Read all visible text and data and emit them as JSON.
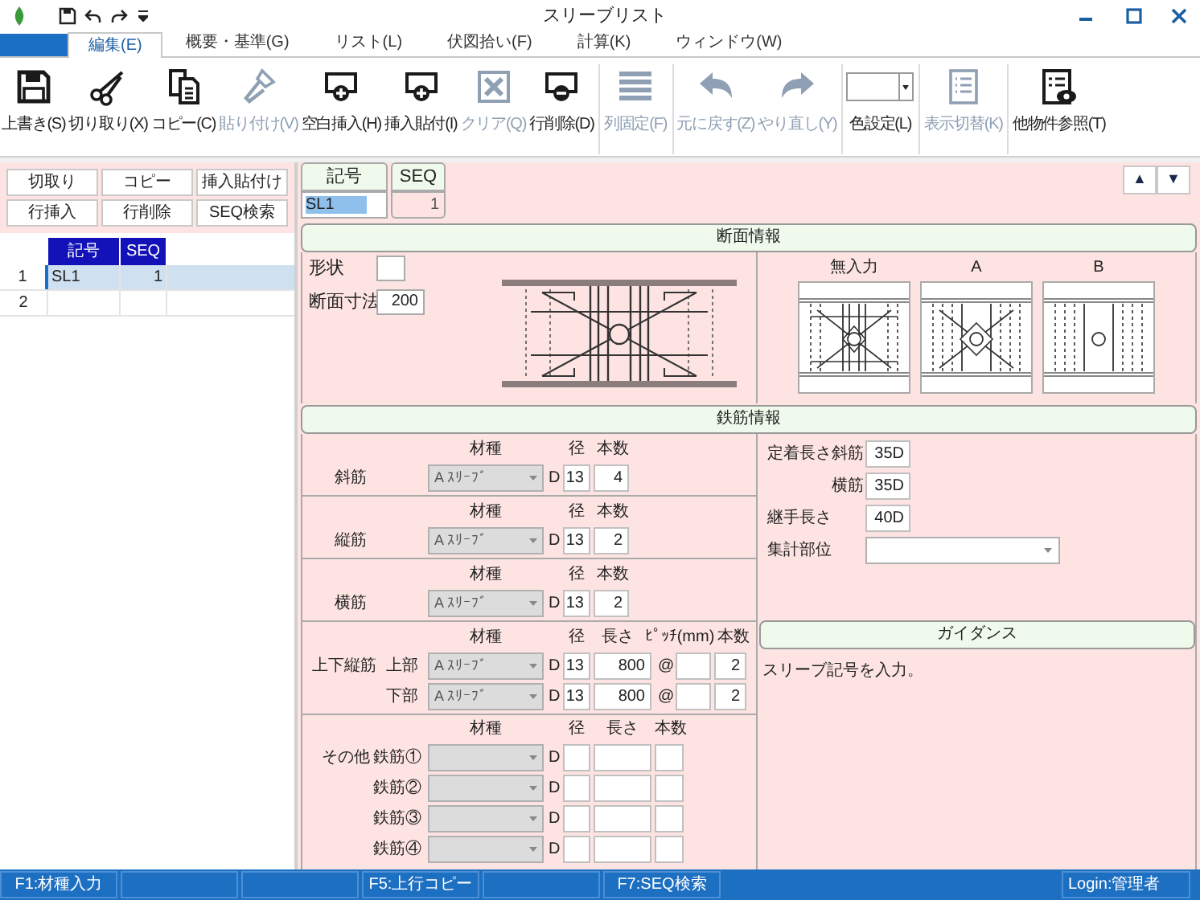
{
  "window": {
    "title": "スリーブリスト"
  },
  "tabs": [
    {
      "label": "編集(E)",
      "selected": true
    },
    {
      "label": "概要・基準(G)",
      "selected": false
    },
    {
      "label": "リスト(L)",
      "selected": false
    },
    {
      "label": "伏図拾い(F)",
      "selected": false
    },
    {
      "label": "計算(K)",
      "selected": false
    },
    {
      "label": "ウィンドウ(W)",
      "selected": false
    }
  ],
  "ribbon_groups": [
    [
      {
        "label": "上書き(S)",
        "kind": "save",
        "disabled": false
      },
      {
        "label": "切り取り(X)",
        "kind": "cut",
        "disabled": false
      },
      {
        "label": "コピー(C)",
        "kind": "copy",
        "disabled": false
      },
      {
        "label": "貼り付け(V)",
        "kind": "paste",
        "disabled": true
      },
      {
        "label": "空白挿入(H)",
        "kind": "insert",
        "disabled": false
      },
      {
        "label": "挿入貼付(I)",
        "kind": "insert",
        "disabled": false
      },
      {
        "label": "クリア(Q)",
        "kind": "clear",
        "disabled": true
      },
      {
        "label": "行削除(D)",
        "kind": "delete",
        "disabled": false
      }
    ],
    [
      {
        "label": "列固定(F)",
        "kind": "freeze",
        "disabled": true
      }
    ],
    [
      {
        "label": "元に戻す(Z)",
        "kind": "undo",
        "disabled": true
      },
      {
        "label": "やり直し(Y)",
        "kind": "redo",
        "disabled": true
      }
    ],
    [
      {
        "label": "色設定(L)",
        "kind": "color",
        "disabled": false
      }
    ],
    [
      {
        "label": "表示切替(K)",
        "kind": "toggle",
        "disabled": true
      }
    ],
    [
      {
        "label": "他物件参照(T)",
        "kind": "reference",
        "disabled": false
      }
    ]
  ],
  "left_panel": {
    "buttons": [
      "切取り",
      "コピー",
      "挿入貼付け",
      "行挿入",
      "行削除",
      "SEQ検索"
    ],
    "grid": {
      "columns": [
        "記号",
        "SEQ"
      ],
      "rows": [
        {
          "number": "1",
          "symbol": "SL1",
          "seq": "1",
          "selected": true
        },
        {
          "number": "2",
          "selected": false
        }
      ]
    }
  },
  "record": {
    "symbol_label": "記号",
    "seq_label": "SEQ",
    "symbol_value": "SL1",
    "symbol_highlighted": true,
    "seq_value": "1",
    "nav_buttons": [
      "▲",
      "▼"
    ]
  },
  "section_info": {
    "title": "断面情報",
    "shape_label": "形状",
    "size_label": "断面寸法",
    "size_value": "200",
    "options": [
      {
        "label": "無入力",
        "kind": "none"
      },
      {
        "label": "A",
        "kind": "a"
      },
      {
        "label": "B",
        "kind": "b"
      }
    ]
  },
  "rebar_info": {
    "title": "鉄筋情報",
    "simple_rows": [
      {
        "label": "斜筋",
        "headers": [
          "材種",
          "径",
          "本数"
        ],
        "material": "A ｽﾘｰﾌﾞ",
        "prefix": "D",
        "diameter": "13",
        "count": "4",
        "disabled": true
      },
      {
        "label": "縦筋",
        "headers": [
          "材種",
          "径",
          "本数"
        ],
        "material": "A ｽﾘｰﾌﾞ",
        "prefix": "D",
        "diameter": "13",
        "count": "2",
        "disabled": true
      },
      {
        "label": "横筋",
        "headers": [
          "材種",
          "径",
          "本数"
        ],
        "material": "A ｽﾘｰﾌﾞ",
        "prefix": "D",
        "diameter": "13",
        "count": "2",
        "disabled": true
      }
    ],
    "upper_lower": {
      "label": "上下縦筋",
      "headers": [
        "材種",
        "径",
        "長さ",
        "ﾋﾟｯﾁ(mm)",
        "本数"
      ],
      "rows": [
        {
          "label": "上部",
          "material": "A ｽﾘｰﾌﾞ",
          "prefix": "D",
          "diameter": "13",
          "length": "800",
          "at": "@",
          "count": "2",
          "disabled": true
        },
        {
          "label": "下部",
          "material": "A ｽﾘｰﾌﾞ",
          "prefix": "D",
          "diameter": "13",
          "length": "800",
          "at": "@",
          "count": "2",
          "disabled": true
        }
      ]
    },
    "others": {
      "label": "その他",
      "headers": [
        "材種",
        "径",
        "長さ",
        "本数"
      ],
      "rows": [
        {
          "label": "鉄筋①",
          "prefix": "D",
          "disabled": true
        },
        {
          "label": "鉄筋②",
          "prefix": "D",
          "disabled": true
        },
        {
          "label": "鉄筋③",
          "prefix": "D",
          "disabled": true
        },
        {
          "label": "鉄筋④",
          "prefix": "D",
          "disabled": true
        }
      ]
    },
    "anchorage": {
      "label": "定着長さ",
      "rows": [
        {
          "label": "斜筋",
          "value": "35D"
        },
        {
          "label": "横筋",
          "value": "35D"
        }
      ]
    },
    "joint": {
      "label": "継手長さ",
      "value": "40D"
    },
    "tally": {
      "label": "集計部位"
    }
  },
  "guidance": {
    "title": "ガイダンス",
    "text": "スリーブ記号を入力。"
  },
  "status_bar": {
    "segments": [
      {
        "kind": "key",
        "text": "F1:材種入力"
      },
      {
        "kind": "blank"
      },
      {
        "kind": "blank"
      },
      {
        "kind": "key",
        "text": "F5:上行コピー"
      },
      {
        "kind": "blank"
      },
      {
        "kind": "key",
        "text": "F7:SEQ検索"
      }
    ],
    "login": "Login:管理者"
  }
}
